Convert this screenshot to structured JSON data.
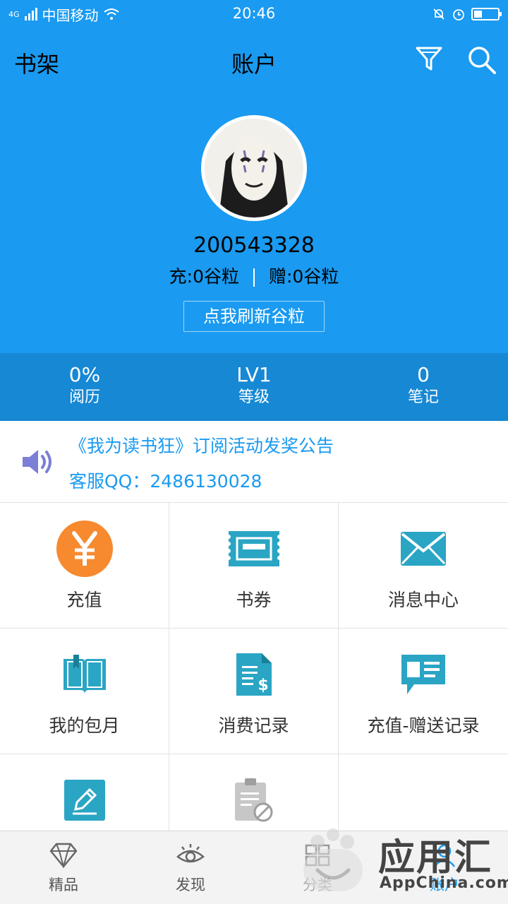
{
  "status_bar": {
    "network": "4G",
    "carrier": "中国移动",
    "time": "20:46",
    "battery_level": 0.35
  },
  "nav": {
    "left_label": "书架",
    "title": "账户"
  },
  "profile": {
    "user_id": "200543328",
    "charge": "充:0谷粒",
    "gift": "赠:0谷粒",
    "refresh_label": "点我刷新谷粒"
  },
  "stats": [
    {
      "value": "0%",
      "label": "阅历"
    },
    {
      "value": "LV1",
      "label": "等级"
    },
    {
      "value": "0",
      "label": "笔记"
    }
  ],
  "notice": {
    "line1": "《我为读书狂》订阅活动发奖公告",
    "line2": "客服QQ：2486130028"
  },
  "grid": [
    {
      "label": "充值",
      "icon": "yuan-coin-icon"
    },
    {
      "label": "书券",
      "icon": "ticket-icon"
    },
    {
      "label": "消息中心",
      "icon": "envelope-icon"
    },
    {
      "label": "我的包月",
      "icon": "open-book-icon"
    },
    {
      "label": "消费记录",
      "icon": "bill-dollar-icon"
    },
    {
      "label": "充值-赠送记录",
      "icon": "chat-card-icon"
    },
    {
      "label": "",
      "icon": "pencil-edit-icon"
    },
    {
      "label": "",
      "icon": "clipboard-ban-icon"
    }
  ],
  "tabs": [
    {
      "label": "精品",
      "icon": "diamond-icon"
    },
    {
      "label": "发现",
      "icon": "eye-icon"
    },
    {
      "label": "分类",
      "icon": "category-icon"
    },
    {
      "label": "账户",
      "icon": "account-icon"
    }
  ],
  "watermark": {
    "title": "应用汇",
    "subtitle": "AppChina.com"
  },
  "colors": {
    "primary": "#1a9af0",
    "stats_bg": "#1788d4",
    "icon_teal": "#2aa5c4",
    "coin_orange": "#f7892f"
  }
}
